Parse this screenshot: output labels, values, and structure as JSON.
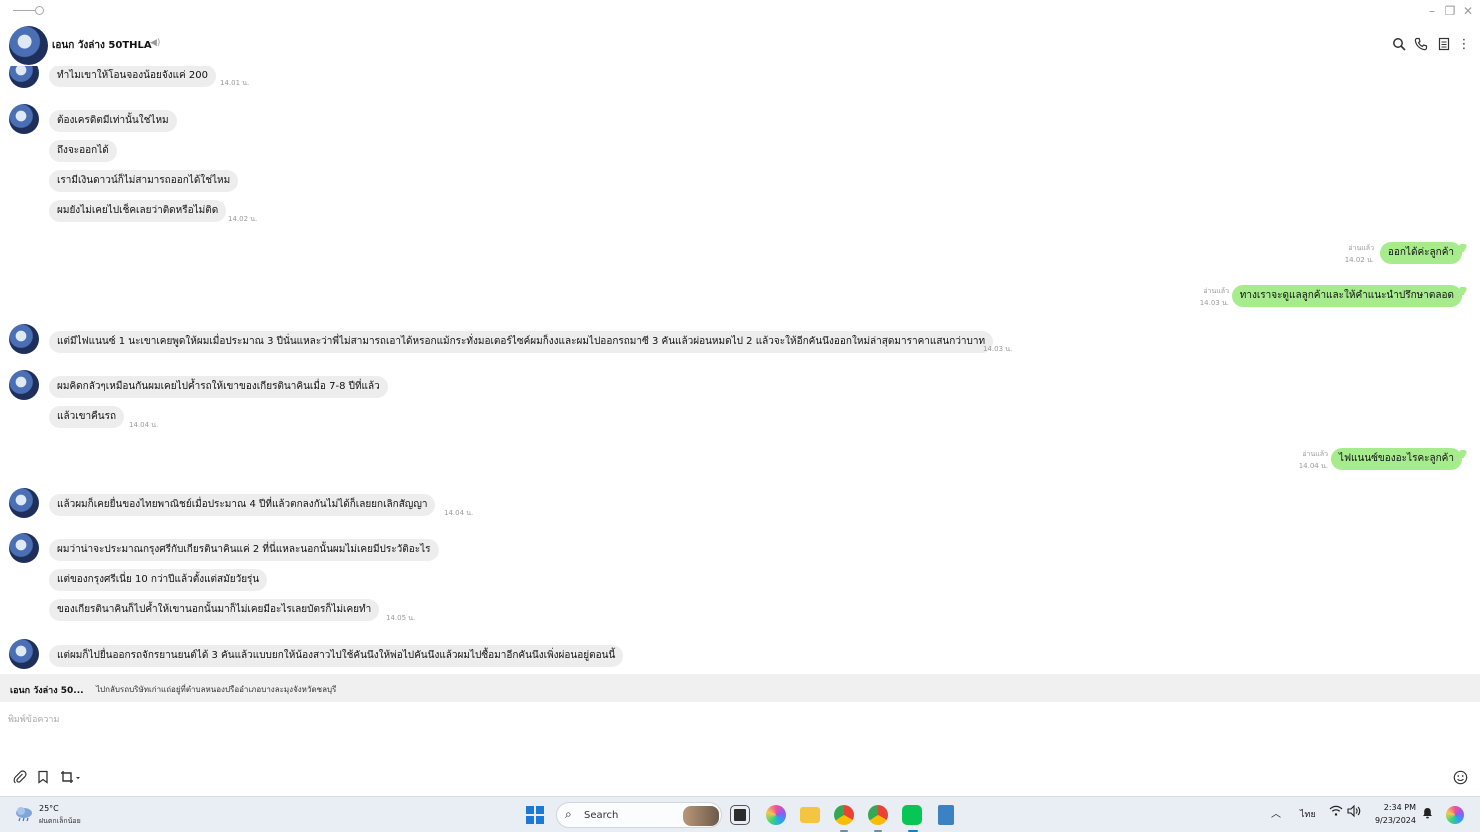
{
  "chat": {
    "name": "เอนก วังล่าง 50THLA",
    "colors": {
      "incoming_bubble": "#ededed",
      "outgoing_bubble": "#a6ec8c",
      "timestamp": "#9a9a9a"
    }
  },
  "messages": [
    {
      "dir": "in",
      "text": "ทำไมเขาให้โอนจองน้อยจังแค่ 200",
      "time": "14.01 น."
    },
    {
      "dir": "in",
      "text": "ต้องเครดิตมีเท่านั้นใช่ไหม",
      "time": ""
    },
    {
      "dir": "in",
      "text": "ถึงจะออกได้",
      "time": ""
    },
    {
      "dir": "in",
      "text": "เรามีเงินดาวน์ก็ไม่สามารถออกได้ใช่ไหม",
      "time": ""
    },
    {
      "dir": "in",
      "text": "ผมยังไม่เคยไปเช็คเลยว่าติดหรือไม่ติด",
      "time": "14.02 น."
    },
    {
      "dir": "out",
      "text": "ออกได้ค่ะลูกค้า",
      "read": "อ่านแล้ว",
      "time": "14.02 น."
    },
    {
      "dir": "out",
      "text": "ทางเราจะดูแลลูกค้าและให้คำแนะนำปรึกษาตลอด",
      "read": "อ่านแล้ว",
      "time": "14.03 น."
    },
    {
      "dir": "in",
      "text": "แต่มีไฟแนนซ์ 1 นะเขาเคยพูดให้ผมเมื่อประมาณ 3 ปีนั่นแหละว่าพี่ไม่สามารถเอาได้หรอกแม้กระทั่งมอเตอร์ไซค์ผมก็งงและผมไปออกรถมาซี 3 คันแล้วผ่อนหมดไป 2 แล้วจะให้อีกคันนึงออกใหม่ล่าสุดมาราคาแสนกว่าบาท",
      "time": "14.03 น."
    },
    {
      "dir": "in",
      "text": "ผมคิดกลัวๆเหมือนกันผมเคยไปค้ำรถให้เขาของเกียรตินาคินเมื่อ 7-8 ปีที่แล้ว",
      "time": ""
    },
    {
      "dir": "in",
      "text": "แล้วเขาคืนรถ",
      "time": "14.04 น."
    },
    {
      "dir": "out",
      "text": "ไฟแนนซ์ของอะไรคะลูกค้า",
      "read": "อ่านแล้ว",
      "time": "14.04 น."
    },
    {
      "dir": "in",
      "text": "แล้วผมก็เคยยื่นของไทยพาณิชย์เมื่อประมาณ 4 ปีที่แล้วตกลงกันไม่ได้ก็เลยยกเลิกสัญญา",
      "time": "14.04 น."
    },
    {
      "dir": "in",
      "text": "ผมว่าน่าจะประมาณกรุงศรีกับเกียรตินาคินแค่ 2 ที่นี่แหละนอกนั้นผมไม่เคยมีประวัติอะไร",
      "time": ""
    },
    {
      "dir": "in",
      "text": "แต่ของกรุงศรีเนี่ย 10 กว่าปีแล้วตั้งแต่สมัยวัยรุ่น",
      "time": ""
    },
    {
      "dir": "in",
      "text": "ของเกียรตินาคินก็ไปค้ำให้เขานอกนั้นมาก็ไม่เคยมีอะไรเลยบัตรก็ไม่เคยทำ",
      "time": "14.05 น."
    },
    {
      "dir": "in",
      "text": "แต่ผมก็ไปยื่นออกรถจักรยานยนต์ได้ 3 คันแล้วแบบยกให้น้องสาวไปใช้คันนึงให้พ่อไปคันนึงแล้วผมไปซื้อมาอีกคันนึงเพิ่งผ่อนอยู่ตอนนี้",
      "time": ""
    }
  ],
  "preview": {
    "name": "เอนก วังล่าง 50...",
    "text": "ไปกลับรถบริษัทเก่าแถ่อยู่ที่ตำบลหนองปรืออำเภอบางละมุงจังหวัดชลบุรี"
  },
  "input": {
    "placeholder": "พิมพ์ข้อความ"
  },
  "taskbar": {
    "weather_temp": "25°C",
    "weather_desc": "ฝนตกเล็กน้อย",
    "search_label": "Search",
    "language": "ไทย",
    "time": "2:34 PM",
    "date": "9/23/2024"
  }
}
